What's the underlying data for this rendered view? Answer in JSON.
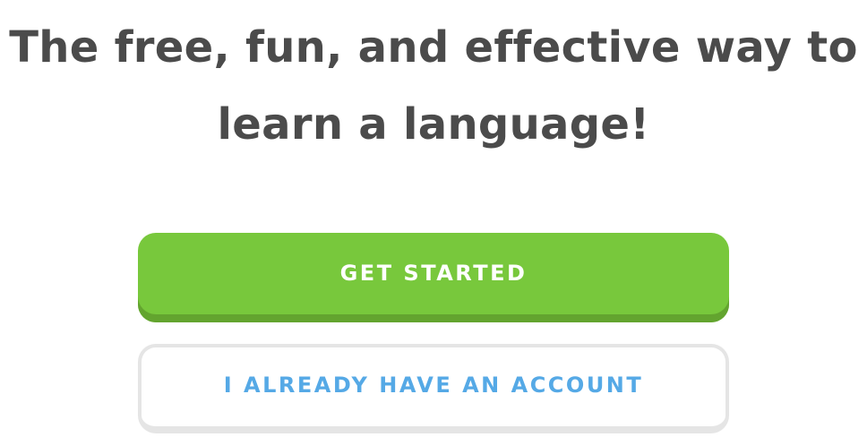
{
  "hero": {
    "headline_line1": "The free, fun, and effective way to",
    "headline_line2": "learn a language!"
  },
  "actions": {
    "get_started_label": "GET STARTED",
    "have_account_label": "I ALREADY HAVE AN ACCOUNT"
  },
  "colors": {
    "text_dark": "#4b4b4b",
    "primary_green": "#78c83c",
    "primary_green_shadow": "#63a42f",
    "secondary_text_blue": "#55a9e6",
    "secondary_border": "#e5e5e5"
  }
}
